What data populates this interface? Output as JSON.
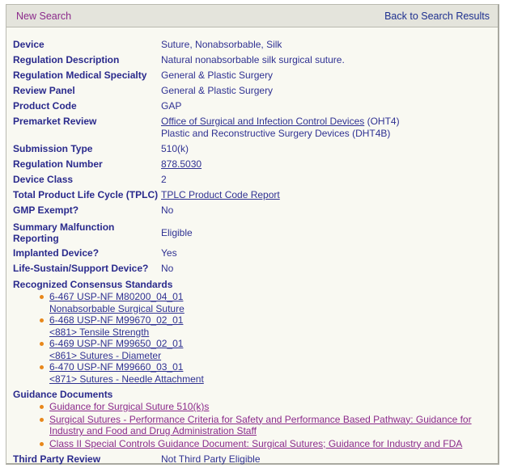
{
  "topbar": {
    "new_search_label": "New Search",
    "back_label": "Back to Search Results"
  },
  "colors": {
    "panel_bg": "#f9f9f2",
    "header_bg": "#e4e4dc",
    "label_text": "#2a2a8c",
    "value_text": "#2f3192",
    "visited_link": "#8b2a8b",
    "bullet": "#e8871a",
    "border": "#b9b9b0"
  },
  "fields": {
    "device": {
      "label": "Device",
      "value": "Suture, Nonabsorbable, Silk"
    },
    "regulation_description": {
      "label": "Regulation Description",
      "value": "Natural nonabsorbable silk surgical suture."
    },
    "regulation_medical_specialty": {
      "label": "Regulation Medical Specialty",
      "value": "General & Plastic Surgery"
    },
    "review_panel": {
      "label": "Review Panel",
      "value": "General & Plastic Surgery"
    },
    "product_code": {
      "label": "Product Code",
      "value": "GAP"
    },
    "premarket_review": {
      "label": "Premarket Review",
      "line1_link": "Office of Surgical and Infection Control Devices",
      "line1_suffix": " (OHT4)",
      "line2": "Plastic and Reconstructive Surgery Devices (DHT4B)"
    },
    "submission_type": {
      "label": "Submission Type",
      "value": "510(k)"
    },
    "regulation_number": {
      "label": "Regulation Number",
      "value": "878.5030"
    },
    "device_class": {
      "label": "Device Class",
      "value": "2"
    },
    "tplc": {
      "label": "Total Product Life Cycle (TPLC)",
      "value": "TPLC Product Code Report"
    },
    "gmp_exempt": {
      "label": "GMP Exempt?",
      "value": "No"
    },
    "summary_malfunction": {
      "label_line1": "Summary Malfunction",
      "label_line2": "Reporting",
      "value": "Eligible"
    },
    "implanted_device": {
      "label": "Implanted Device?",
      "value": "Yes"
    },
    "life_sustain": {
      "label": "Life-Sustain/Support Device?",
      "value": "No"
    },
    "third_party_review": {
      "label": "Third Party Review",
      "value": "Not Third Party Eligible"
    }
  },
  "consensus_standards": {
    "title": "Recognized Consensus Standards",
    "items": [
      {
        "code": "6-467 USP-NF M80200_04_01",
        "name": "Nonabsorbable Surgical Suture"
      },
      {
        "code": "6-468 USP-NF M99670_02_01",
        "name": "<881> Tensile Strength"
      },
      {
        "code": "6-469 USP-NF M99650_02_01",
        "name": "<861> Sutures - Diameter"
      },
      {
        "code": "6-470 USP-NF M99660_03_01",
        "name": "<871> Sutures - Needle Attachment"
      }
    ]
  },
  "guidance_documents": {
    "title": "Guidance Documents",
    "items": [
      "Guidance for Surgical Suture 510(k)s",
      "Surgical Sutures - Performance Criteria for Safety and Performance Based Pathway: Guidance for Industry and Food and Drug Administration Staff",
      "Class II Special Controls Guidance Document: Surgical Sutures; Guidance for Industry and FDA"
    ]
  }
}
